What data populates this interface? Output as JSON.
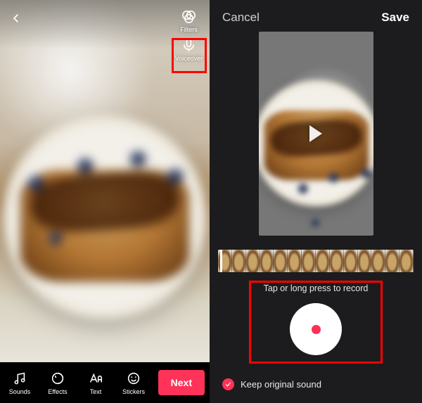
{
  "left": {
    "side_tools": {
      "filters": "Filters",
      "voiceover": "Voiceover"
    },
    "bottom_tools": {
      "sounds": "Sounds",
      "effects": "Effects",
      "text": "Text",
      "stickers": "Stickers"
    },
    "next_label": "Next"
  },
  "right": {
    "cancel_label": "Cancel",
    "save_label": "Save",
    "record_hint": "Tap or long press to record",
    "keep_original_label": "Keep original sound",
    "keep_original_checked": true
  },
  "colors": {
    "accent": "#ff3359",
    "highlight": "#ff0000",
    "bg_dark": "#1c1c1e"
  }
}
